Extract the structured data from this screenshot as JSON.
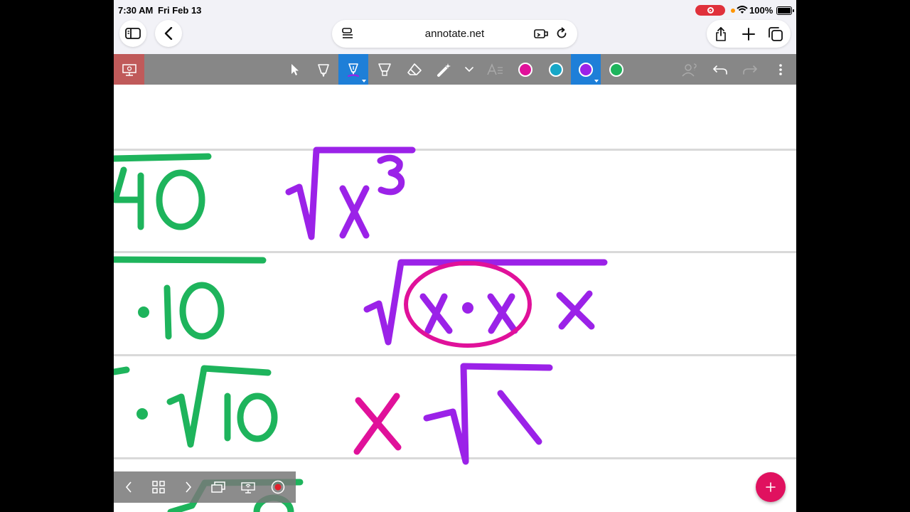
{
  "status_bar": {
    "time": "7:30 AM",
    "date": "Fri Feb 13",
    "battery": "100%",
    "recording_color": "#e0313b"
  },
  "browser": {
    "url": "annotate.net",
    "left_icons": [
      "sidebar-icon",
      "back-chevron-icon"
    ],
    "address_icons": [
      "reader-icon",
      "extension-icon",
      "reload-icon"
    ],
    "right_icons": [
      "share-icon",
      "plus-icon",
      "tabs-icon"
    ]
  },
  "toolbar": {
    "background": "#878787",
    "presenter_color": "#c05a5a",
    "active_color": "#1e7fd8",
    "tools": [
      "pointer-icon",
      "highlighter-icon",
      "pen-icon",
      "marker-icon",
      "eraser-icon",
      "laser-icon",
      "chevron-down-icon",
      "text-icon"
    ],
    "active_tool": "pen-icon",
    "swatches": [
      "#e0119a",
      "#17a7c7",
      "#9b22e8",
      "#1eb45c"
    ],
    "active_swatch": "#9b22e8",
    "right_tools": [
      "user-icon",
      "undo-icon",
      "redo-icon",
      "more-icon"
    ]
  },
  "canvas": {
    "ink_colors": {
      "green": "#1eb45c",
      "purple": "#9b22e8",
      "magenta": "#e0119a"
    }
  },
  "bottom_nav": {
    "icons": [
      "prev-icon",
      "grid-icon",
      "next-icon",
      "pages-icon",
      "cast-icon",
      "record-icon"
    ]
  },
  "fab": {
    "label": "+",
    "color": "#e0115f"
  }
}
